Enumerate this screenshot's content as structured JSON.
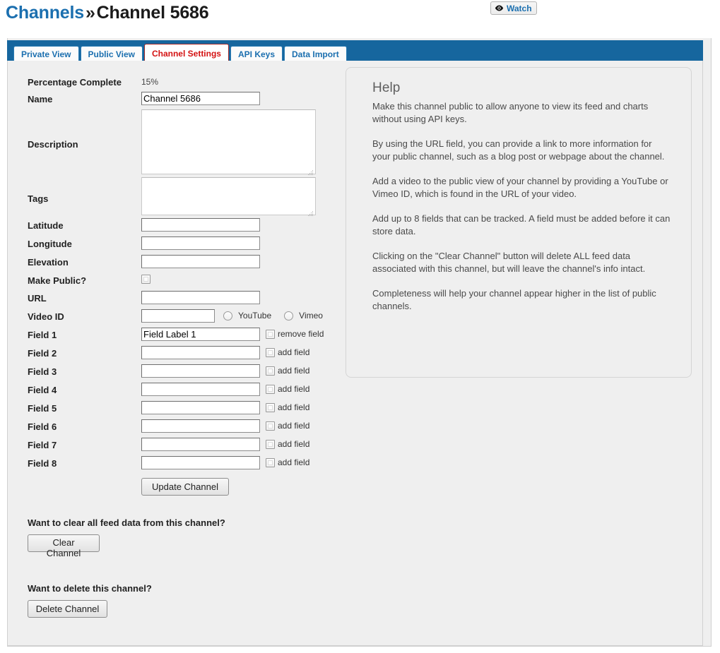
{
  "breadcrumb": {
    "root": "Channels",
    "separator": "»",
    "current": "Channel 5686"
  },
  "watch_button": {
    "label": "Watch",
    "icon": "eye-icon"
  },
  "tabs": [
    {
      "label": "Private View",
      "active": false
    },
    {
      "label": "Public View",
      "active": false
    },
    {
      "label": "Channel Settings",
      "active": true
    },
    {
      "label": "API Keys",
      "active": false
    },
    {
      "label": "Data Import",
      "active": false
    }
  ],
  "form": {
    "percentage_complete": {
      "label": "Percentage Complete",
      "value": "15%"
    },
    "name": {
      "label": "Name",
      "value": "Channel 5686"
    },
    "description": {
      "label": "Description",
      "value": ""
    },
    "tags": {
      "label": "Tags",
      "value": ""
    },
    "latitude": {
      "label": "Latitude",
      "value": ""
    },
    "longitude": {
      "label": "Longitude",
      "value": ""
    },
    "elevation": {
      "label": "Elevation",
      "value": ""
    },
    "make_public": {
      "label": "Make Public?",
      "checked": false
    },
    "url": {
      "label": "URL",
      "value": ""
    },
    "video_id": {
      "label": "Video ID",
      "value": "",
      "options": [
        {
          "label": "YouTube",
          "selected": false
        },
        {
          "label": "Vimeo",
          "selected": false
        }
      ]
    },
    "fields": [
      {
        "label": "Field 1",
        "value": "Field Label 1",
        "toggle_label": "remove field",
        "checked": false
      },
      {
        "label": "Field 2",
        "value": "",
        "toggle_label": "add field",
        "checked": false
      },
      {
        "label": "Field 3",
        "value": "",
        "toggle_label": "add field",
        "checked": false
      },
      {
        "label": "Field 4",
        "value": "",
        "toggle_label": "add field",
        "checked": false
      },
      {
        "label": "Field 5",
        "value": "",
        "toggle_label": "add field",
        "checked": false
      },
      {
        "label": "Field 6",
        "value": "",
        "toggle_label": "add field",
        "checked": false
      },
      {
        "label": "Field 7",
        "value": "",
        "toggle_label": "add field",
        "checked": false
      },
      {
        "label": "Field 8",
        "value": "",
        "toggle_label": "add field",
        "checked": false
      }
    ],
    "update_button": "Update Channel"
  },
  "clear_section": {
    "question": "Want to clear all feed data from this channel?",
    "button": "Clear Channel"
  },
  "delete_section": {
    "question": "Want to delete this channel?",
    "button": "Delete Channel"
  },
  "help": {
    "title": "Help",
    "paragraphs": [
      "Make this channel public to allow anyone to view its feed and charts without using API keys.",
      "By using the URL field, you can provide a link to more information for your public channel, such as a blog post or webpage about the channel.",
      "Add a video to the public view of your channel by providing a YouTube or Vimeo ID, which is found in the URL of your video.",
      "Add up to 8 fields that can be tracked. A field must be added before it can store data.",
      "Clicking on the \"Clear Channel\" button will delete ALL feed data associated with this channel, but will leave the channel's info intact.",
      "Completeness will help your channel appear higher in the list of public channels."
    ]
  },
  "colors": {
    "link_blue": "#1b6faf",
    "tab_bar_blue": "#16669e",
    "active_tab_red": "#d41212",
    "page_bg": "#efefef"
  }
}
